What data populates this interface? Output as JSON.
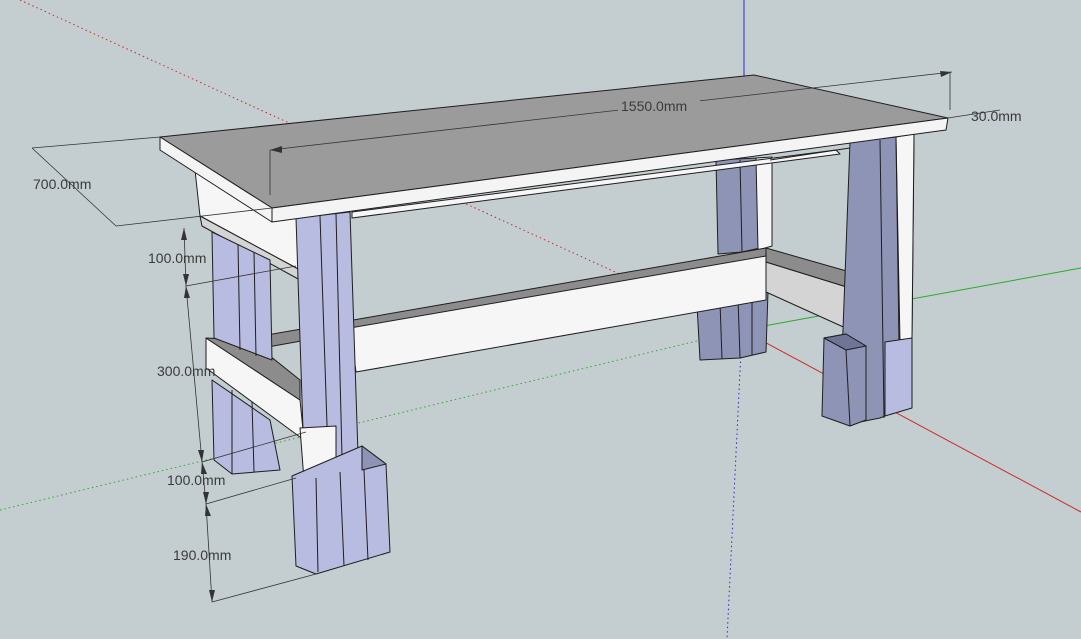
{
  "viewport": {
    "background": "#c4ced0"
  },
  "colors": {
    "leg_side": "#b8bce0",
    "leg_front": "#8e94b6",
    "leg_dark": "#6f7597",
    "top_surface": "#9b9b9b",
    "top_edge": "#f4f4f4",
    "rail_white": "#f6f6f6",
    "rail_grey": "#d4d4d4",
    "rail_dark": "#8c8c8c",
    "edge": "#1e1e1e",
    "axis_red": "#cc2a2a",
    "axis_green": "#2da82d",
    "axis_blue": "#2a2ad0",
    "dim_line": "#333333"
  },
  "dimensions": {
    "length": "1550.0mm",
    "thickness": "30.0mm",
    "depth": "700.0mm",
    "apron": "100.0mm",
    "leg_span": "300.0mm",
    "stretcher": "100.0mm",
    "foot": "190.0mm"
  }
}
